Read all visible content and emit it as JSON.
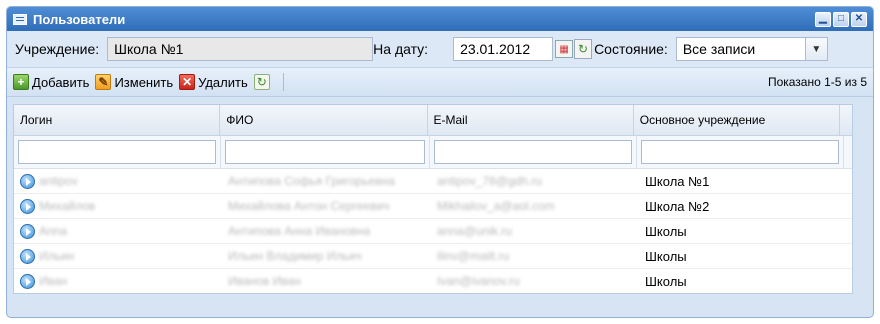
{
  "window": {
    "title": "Пользователи"
  },
  "filter": {
    "institution_label": "Учреждение:",
    "institution_value": "Школа №1",
    "date_label": "На дату:",
    "date_value": "23.01.2012",
    "state_label": "Состояние:",
    "state_value": "Все записи"
  },
  "toolbar": {
    "add_label": "Добавить",
    "edit_label": "Изменить",
    "delete_label": "Удалить",
    "shown_text": "Показано 1-5 из 5"
  },
  "grid": {
    "headers": [
      "Логин",
      "ФИО",
      "E-Mail",
      "Основное учреждение"
    ],
    "rows": [
      {
        "login": "antipov",
        "fio": "Антипова Софья Григорьевна",
        "email": "antipov_78@gdh.ru",
        "school": "Школа №1"
      },
      {
        "login": "Михайлов",
        "fio": "Михайлова Антон Сергеевич",
        "email": "Mikhailov_a@aol.com",
        "school": "Школа №2"
      },
      {
        "login": "Anna",
        "fio": "Антипова Анна Ивановна",
        "email": "anna@unik.ru",
        "school": "Школы"
      },
      {
        "login": "Ильин",
        "fio": "Ильин Владимир Ильич",
        "email": "ilinv@mailt.ru",
        "school": "Школы"
      },
      {
        "login": "Иван",
        "fio": "Иванов Иван",
        "email": "Ivan@ivanov.ru",
        "school": "Школы"
      }
    ]
  },
  "colors": {
    "title_bar": "#3a7bc8",
    "window_bg": "#d6e4f4"
  }
}
